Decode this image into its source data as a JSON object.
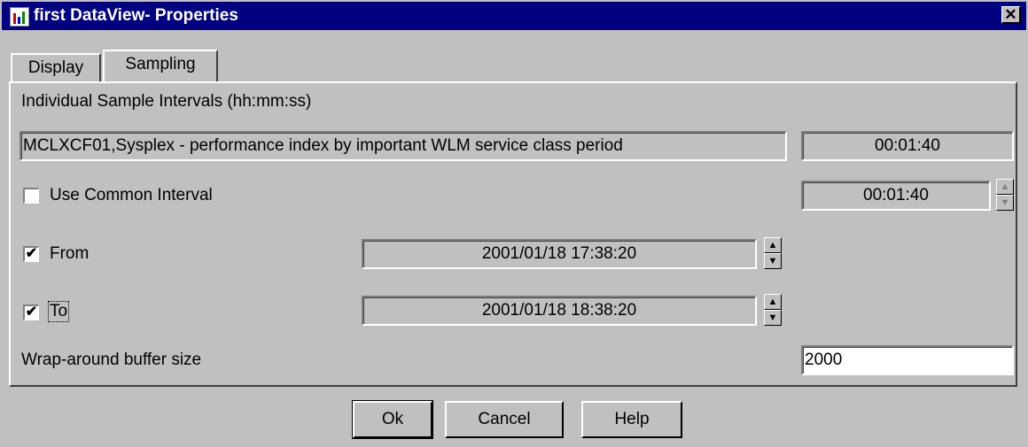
{
  "window": {
    "title": "first DataView- Properties",
    "close_glyph": "✕"
  },
  "tabs": [
    {
      "label": "Display"
    },
    {
      "label": "Sampling"
    }
  ],
  "sampling": {
    "intervals_heading": "Individual Sample Intervals (hh:mm:ss)",
    "metric_name": "MCLXCF01,Sysplex - performance index by important WLM service class period",
    "metric_interval": "00:01:40",
    "use_common_label": "Use Common Interval",
    "use_common_checked": false,
    "common_interval": "00:01:40",
    "from_label": "From",
    "from_checked": true,
    "from_value": "2001/01/18 17:38:20",
    "to_label": "To",
    "to_checked": true,
    "to_value": "2001/01/18 18:38:20",
    "buffer_label": "Wrap-around buffer size",
    "buffer_value": "2000"
  },
  "buttons": {
    "ok": "Ok",
    "cancel": "Cancel",
    "help": "Help"
  },
  "icons": {
    "spin_up": "▲",
    "spin_down": "▼",
    "check": "✔"
  }
}
